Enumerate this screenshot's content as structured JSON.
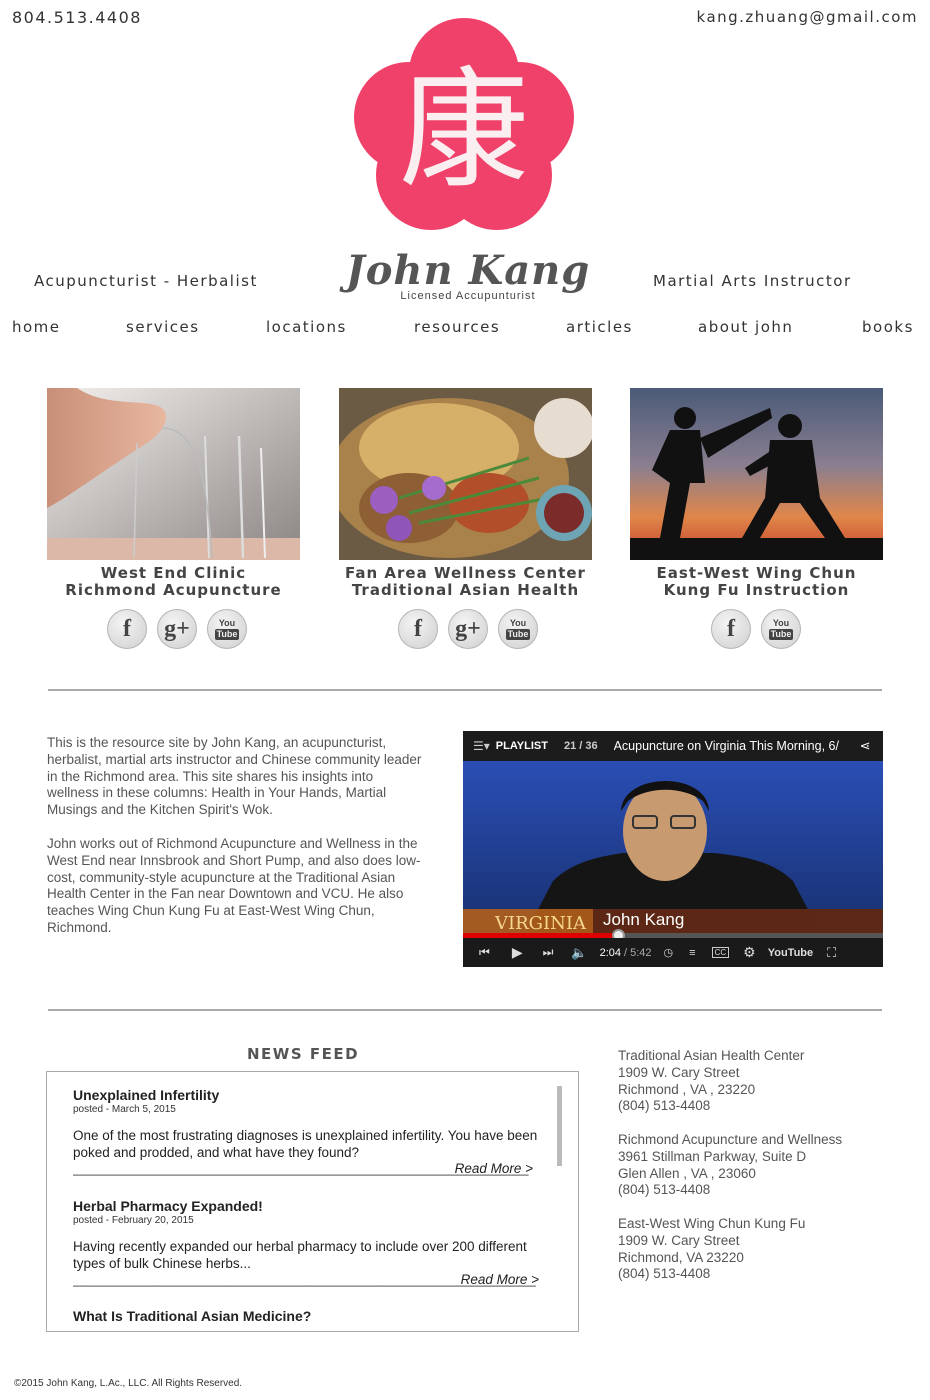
{
  "header": {
    "phone": "804.513.4408",
    "email": "kang.zhuang@gmail.com",
    "logo_glyph": "康",
    "logo_color": "#f0416a",
    "tagline_left": "Acupuncturist - Herbalist",
    "brand_name": "John Kang",
    "brand_subtitle": "Licensed Accupunturist",
    "tagline_right": "Martial Arts Instructor"
  },
  "nav": {
    "items": [
      "home",
      "services",
      "locations",
      "resources",
      "articles",
      "about john",
      "books"
    ]
  },
  "cards": [
    {
      "title1": "West End Clinic",
      "title2": "Richmond Acupuncture",
      "social": [
        "facebook",
        "google-plus",
        "youtube"
      ]
    },
    {
      "title1": "Fan Area Wellness Center",
      "title2": "Traditional Asian Health",
      "social": [
        "facebook",
        "google-plus",
        "youtube"
      ]
    },
    {
      "title1": "East-West Wing Chun",
      "title2": "Kung Fu Instruction",
      "social": [
        "facebook",
        "youtube"
      ]
    }
  ],
  "social_labels": {
    "facebook": "f",
    "google_plus": "g+",
    "youtube_top": "You",
    "youtube_bottom": "Tube"
  },
  "intro": {
    "p1": "This is the resource site by John Kang, an acupuncturist, herbalist, martial arts instructor and Chinese community leader in the Richmond area. This site shares his insights into wellness in these columns: Health in Your Hands, Martial Musings and the Kitchen Spirit's Wok.",
    "p2": "John works out of Richmond Acupuncture and Wellness in the West End near Innsbrook and Short Pump, and also does low-cost, community-style acupuncture at the Traditional Asian Health Center in the Fan near Downtown and VCU. He also teaches Wing Chun Kung Fu at East-West Wing Chun, Richmond."
  },
  "video": {
    "playlist_label": "PLAYLIST",
    "playlist_position": "21 / 36",
    "title": "Acupuncture on Virginia This Morning, 6/",
    "lower_third_station": "VIRGINIA",
    "lower_third_name": "John Kang",
    "time_current": "2:04",
    "time_total": "/ 5:42",
    "progress": 0.37,
    "youtube_label": "YouTube"
  },
  "news": {
    "title": "NEWS FEED",
    "items": [
      {
        "headline": "Unexplained Infertility",
        "date": "posted - March 5, 2015",
        "body": "One of the most frustrating diagnoses is unexplained infertility. You have been poked and prodded, and what have they found?",
        "more": "Read More >",
        "separator": "_______________________________________________________________"
      },
      {
        "headline": "Herbal Pharmacy Expanded!",
        "date": "posted - February 20, 2015",
        "body": "Having recently expanded our herbal pharmacy to include over 200 different types of bulk Chinese herbs...",
        "more": "Read More >",
        "separator": "________________________________________________________________"
      },
      {
        "headline": "What Is Traditional Asian Medicine?"
      }
    ]
  },
  "addresses": [
    {
      "name": "Traditional Asian Health Center",
      "street": "1909 W. Cary Street",
      "city": "Richmond , VA , 23220",
      "phone": "(804) 513-4408"
    },
    {
      "name": "Richmond Acupuncture and Wellness",
      "street": "3961 Stillman Parkway, Suite D",
      "city": "Glen Allen , VA , 23060",
      "phone": "(804) 513-4408"
    },
    {
      "name": "East-West Wing Chun Kung Fu",
      "street": "1909 W. Cary Street",
      "city": "Richmond, VA 23220",
      "phone": "(804) 513-4408"
    }
  ],
  "footer": {
    "copyright": "©2015 John Kang, L.Ac., LLC. All Rights Reserved."
  }
}
